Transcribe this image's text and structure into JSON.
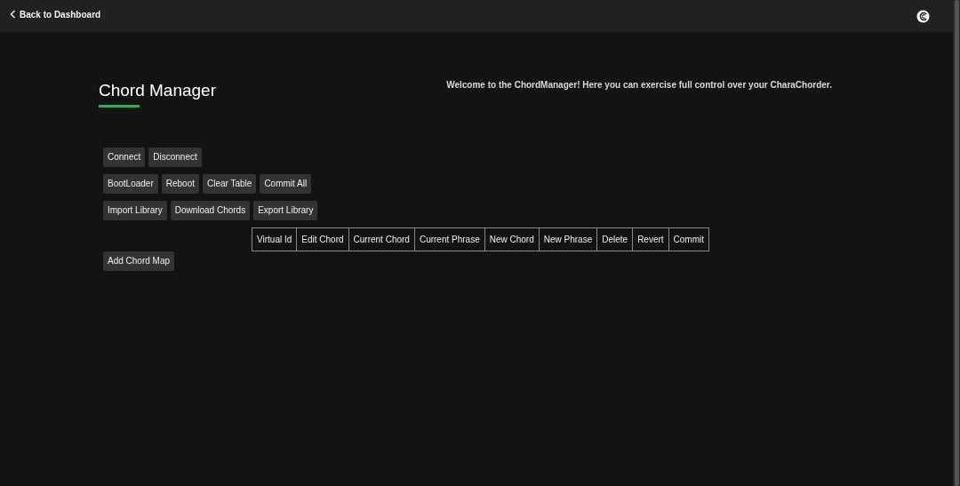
{
  "header": {
    "back_link": "Back to Dashboard"
  },
  "page": {
    "title": "Chord Manager",
    "welcome": "Welcome to the ChordManager! Here you can exercise full control over your CharaChorder."
  },
  "button_rows": [
    [
      "Connect",
      "Disconnect"
    ],
    [
      "BootLoader",
      "Reboot",
      "Clear Table",
      "Commit All"
    ],
    [
      "Import Library",
      "Download Chords",
      "Export Library"
    ]
  ],
  "table": {
    "columns": [
      "Virtual Id",
      "Edit Chord",
      "Current Chord",
      "Current Phrase",
      "New Chord",
      "New Phrase",
      "Delete",
      "Revert",
      "Commit"
    ]
  },
  "add_button": "Add Chord Map"
}
